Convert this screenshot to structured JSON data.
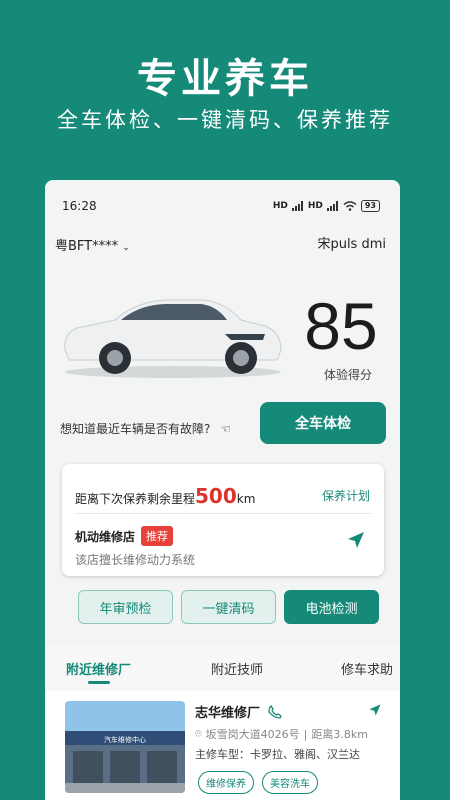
{
  "hero": {
    "title": "专业养车",
    "subtitle": "全车体检、一键清码、保养推荐"
  },
  "status_bar": {
    "time": "16:28",
    "signal1": "HD",
    "signal2": "HD",
    "battery": "93"
  },
  "vehicle": {
    "plate": "粤BFT****",
    "model": "宋puls dmi"
  },
  "score": {
    "value": "85",
    "label": "体验得分"
  },
  "inspection": {
    "question": "想知道最近车辆是否有故障?",
    "button": "全车体检"
  },
  "maintenance": {
    "prefix": "距离下次保养剩余里程",
    "km": "500",
    "unit": "km",
    "plan_link": "保养计划",
    "shop_name": "机动维修店",
    "badge": "推荐",
    "shop_desc": "该店擅长维修动力系统"
  },
  "quick_actions": [
    "年审预检",
    "一键清码",
    "电池检测"
  ],
  "tabs": [
    "附近维修厂",
    "附近技师",
    "修车求助"
  ],
  "repair_shop": {
    "name": "志华维修厂",
    "address": "坂雪岗大道4026号",
    "distance": "距离3.8km",
    "models": "主修车型：卡罗拉、雅阁、汉兰达",
    "photo_sign": "汽车维修中心",
    "tags": [
      "维修保养",
      "美容洗车"
    ]
  },
  "colors": {
    "brand": "#168a78",
    "accent_red": "#d9352c"
  }
}
